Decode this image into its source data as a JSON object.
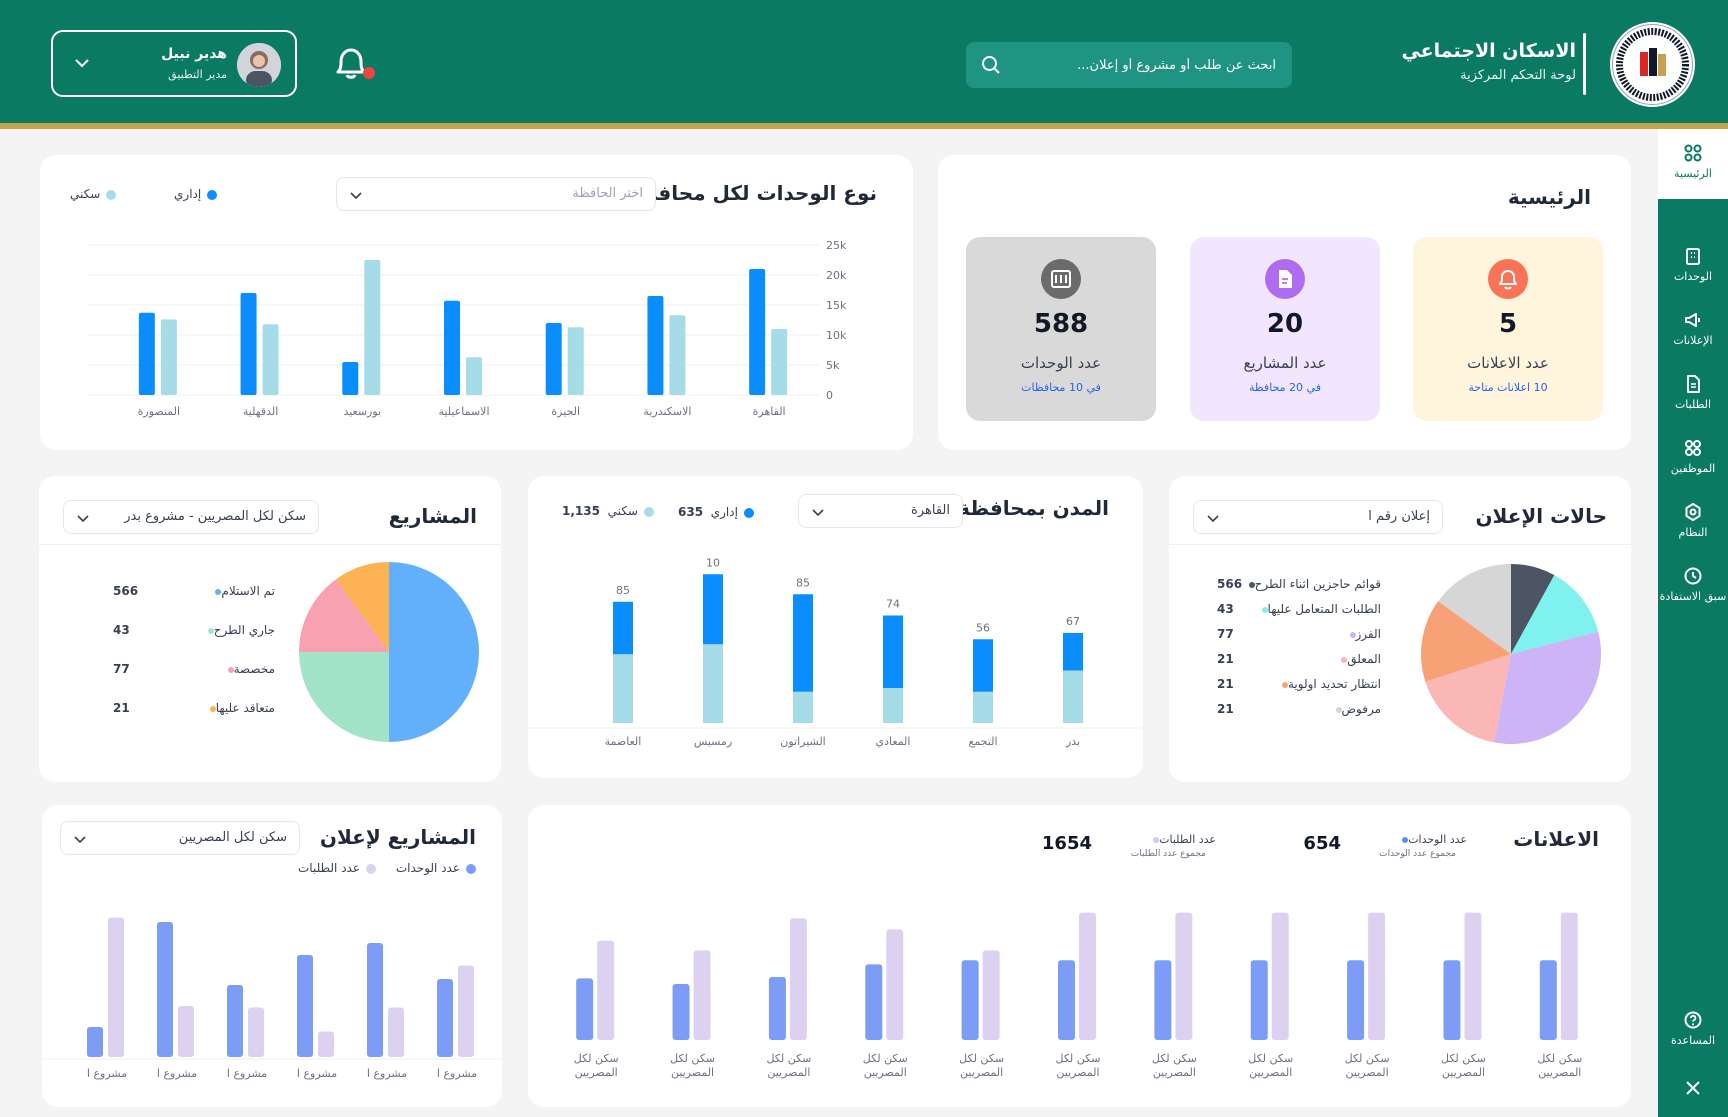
{
  "colors": {
    "primary": "#0b7a63",
    "gold": "#c5a24c",
    "blue": "#0a8dff",
    "light_blue": "#a6dce8",
    "periwinkle": "#7c9cf5",
    "lavender": "#ddd1f2"
  },
  "header": {
    "title": "الاسكان الاجتماعي",
    "subtitle": "لوحة التحكم المركزية",
    "search_placeholder": "ابحث عن طلب أو مشروع أو إعلان...",
    "user_name": "هدير نبيل",
    "user_role": "مدير التطبيق"
  },
  "sidebar": {
    "items": [
      {
        "label": "الرئيسية",
        "icon": "grid-icon",
        "active": true
      },
      {
        "label": "الوحدات",
        "icon": "building-icon"
      },
      {
        "label": "الإعلانات",
        "icon": "megaphone-icon"
      },
      {
        "label": "الطلبات",
        "icon": "document-icon"
      },
      {
        "label": "الموظفين",
        "icon": "users-icon"
      },
      {
        "label": "النظام",
        "icon": "settings-icon"
      },
      {
        "label": "سبق الاستفادة",
        "icon": "history-icon"
      },
      {
        "label": "المساعدة",
        "icon": "help-icon"
      }
    ]
  },
  "home": {
    "title": "الرئيسية",
    "stats": [
      {
        "value": "5",
        "label": "عدد الاعلانات",
        "sub": "10 اعلانات متاحة",
        "bg": "#fff4dc",
        "icon_bg": "#f97356",
        "icon": "bell-icon"
      },
      {
        "value": "20",
        "label": "عدد المشاريع",
        "sub": "في 20 محافظة",
        "bg": "#f2e6ff",
        "icon_bg": "#b06cf0",
        "icon": "file-icon"
      },
      {
        "value": "588",
        "label": "عدد الوحدات",
        "sub": "في 10 محافظات",
        "bg": "#d9d9d9",
        "icon_bg": "#6b6b6b",
        "icon": "building-icon"
      }
    ]
  },
  "unit_types": {
    "title": "نوع الوحدات لكل محافظة",
    "select_placeholder": "اختر الحافظة",
    "legend_admin": "إداري",
    "legend_res": "سكني",
    "chart_data": {
      "type": "bar",
      "categories": [
        "القاهرة",
        "الاسكندرية",
        "الجيزة",
        "الاسماعيلية",
        "بورسعيد",
        "الدقهلية",
        "المنصورة"
      ],
      "series": [
        {
          "name": "إداري",
          "values": [
            21000,
            16500,
            12000,
            15700,
            5500,
            17000,
            13700
          ]
        },
        {
          "name": "سكني",
          "values": [
            11000,
            13300,
            11300,
            6300,
            22500,
            11800,
            12600
          ]
        }
      ],
      "y_ticks": [
        "25k",
        "20k",
        "15k",
        "10k",
        "5k",
        "0"
      ],
      "ylim": [
        0,
        25000
      ]
    }
  },
  "ad_status": {
    "title": "حالات الإعلان",
    "select_value": "إعلان رقم ا",
    "chart_data": {
      "type": "pie",
      "labels": [
        "قوائم حاجزين اثناء الطرح",
        "الطلبات المتعامل عليها",
        "الفرز",
        "المعلق",
        "انتظار تحديد اولوية",
        "مرفوض"
      ],
      "values": [
        566,
        43,
        77,
        21,
        21,
        21
      ],
      "display_values": [
        "566",
        "43",
        "77",
        "21",
        "21",
        "21"
      ],
      "colors": [
        "#4b5563",
        "#7ff2ef",
        "#cdb4f7",
        "#fbb6b6",
        "#f7a176",
        "#d6d6d6"
      ],
      "slice_fractions": [
        0.08,
        0.13,
        0.32,
        0.17,
        0.15,
        0.15
      ]
    }
  },
  "cities": {
    "title": "المدن بمحافظة",
    "select_value": "القاهرة",
    "legend_admin": "إداري",
    "admin_total": "635",
    "legend_res": "سكني",
    "res_total": "1,135",
    "chart_data": {
      "type": "bar",
      "categories": [
        "بدر",
        "التجمع",
        "المعادي",
        "الشيراتون",
        "رمسيس",
        "العاصمة"
      ],
      "totals_labels": [
        "67",
        "56",
        "74",
        "85",
        "10",
        "85"
      ],
      "series": [
        {
          "name": "إداري",
          "values": [
            30,
            42,
            58,
            78,
            56,
            42
          ]
        },
        {
          "name": "سكني",
          "values": [
            42,
            25,
            28,
            25,
            63,
            55
          ]
        }
      ]
    }
  },
  "projects": {
    "title": "المشاريع",
    "select_value": "سكن لكل المصريين - مشروع بدر",
    "chart_data": {
      "type": "pie",
      "labels": [
        "تم الاستلام",
        "جاري الطرح",
        "مخصصة",
        "متعاقد عليها"
      ],
      "values": [
        566,
        43,
        77,
        21
      ],
      "display_values": [
        "566",
        "43",
        "77",
        "21"
      ],
      "colors": [
        "#62b0fb",
        "#a2e4c7",
        "#f8a1b0",
        "#fdb353"
      ],
      "slice_fractions": [
        0.5,
        0.25,
        0.15,
        0.1
      ]
    }
  },
  "ad_projects": {
    "title": "المشاريع لإعلان",
    "select_value": "سكن لكل المصريين",
    "legend_units": "عدد الوحدات",
    "legend_requests": "عدد الطلبات",
    "chart_data": {
      "type": "bar",
      "categories": [
        "مشروع ا",
        "مشروع ا",
        "مشروع ا",
        "مشروع ا",
        "مشروع ا",
        "مشروع ا"
      ],
      "series": [
        {
          "name": "عدد الوحدات",
          "values": [
            52,
            76,
            68,
            48,
            90,
            20
          ]
        },
        {
          "name": "عدد الطلبات",
          "values": [
            61,
            33,
            17,
            33,
            34,
            93
          ]
        }
      ],
      "ylim": [
        0,
        100
      ]
    }
  },
  "ads": {
    "title": "الاعلانات",
    "units_label": "عدد الوحدات",
    "units_sub": "مجموع عدد الوحدات",
    "units_value": "654",
    "requests_label": "عدد الطلبات",
    "requests_sub": "مجموع عدد الطلبات",
    "requests_value": "1654",
    "chart_data": {
      "type": "bar",
      "category_line1": "سكن لكل",
      "category_line2": "المصريين",
      "categories": [
        "سكن لكل المصريين",
        "سكن لكل المصريين",
        "سكن لكل المصريين",
        "سكن لكل المصريين",
        "سكن لكل المصريين",
        "سكن لكل المصريين",
        "سكن لكل المصريين",
        "سكن لكل المصريين",
        "سكن لكل المصريين",
        "سكن لكل المصريين",
        "سكن لكل المصريين"
      ],
      "series": [
        {
          "name": "عدد الوحدات",
          "values": [
            57,
            57,
            57,
            57,
            57,
            57,
            57,
            54,
            45,
            40,
            44
          ]
        },
        {
          "name": "عدد الطلبات",
          "values": [
            91,
            91,
            91,
            91,
            91,
            91,
            64,
            79,
            87,
            64,
            71
          ]
        }
      ],
      "ylim": [
        0,
        100
      ]
    }
  }
}
